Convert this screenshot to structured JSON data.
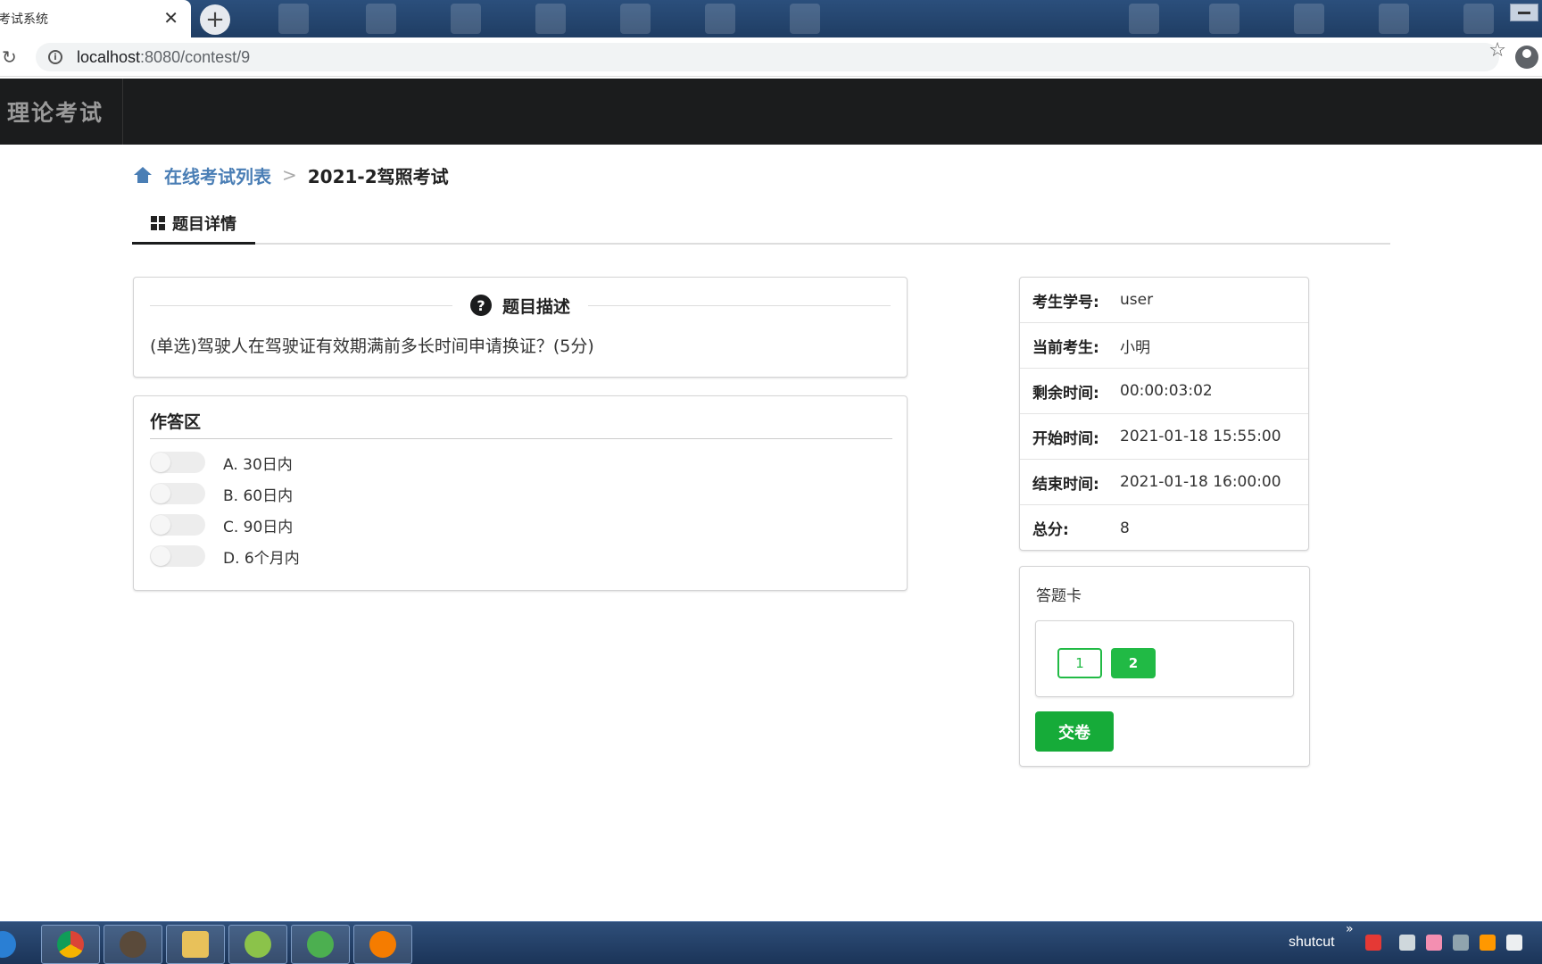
{
  "browser": {
    "tab_title": "考试系统",
    "url_host": "localhost",
    "url_path": ":8080/contest/9"
  },
  "navbar": {
    "brand": "理论考试"
  },
  "breadcrumb": {
    "link": "在线考试列表",
    "separator": ">",
    "current": "2021-2驾照考试"
  },
  "tabs": {
    "detail_label": "题目详情"
  },
  "question": {
    "header": "题目描述",
    "text": "(单选)驾驶人在驾驶证有效期满前多长时间申请换证？(5分)"
  },
  "answer_area": {
    "title": "作答区",
    "options": [
      {
        "label": "A.  30日内"
      },
      {
        "label": "B.  60日内"
      },
      {
        "label": "C.  90日内"
      },
      {
        "label": "D.  6个月内"
      }
    ]
  },
  "exam_info": {
    "rows": [
      {
        "key": "考生学号:",
        "value": "user"
      },
      {
        "key": "当前考生:",
        "value": "小明"
      },
      {
        "key": "剩余时间:",
        "value": "00:00:03:02"
      },
      {
        "key": "开始时间:",
        "value": "2021-01-18 15:55:00"
      },
      {
        "key": "结束时间:",
        "value": "2021-01-18 16:00:00"
      },
      {
        "key": "总分:",
        "value": "8"
      }
    ]
  },
  "answer_sheet": {
    "title": "答题卡",
    "questions": [
      "1",
      "2"
    ],
    "submit_label": "交卷"
  },
  "taskbar": {
    "tray_label": "shutcut",
    "tray_chevron": "»"
  },
  "colors": {
    "link": "#4a7eb5",
    "success": "#21ba45",
    "navbar": "#1b1c1d"
  }
}
